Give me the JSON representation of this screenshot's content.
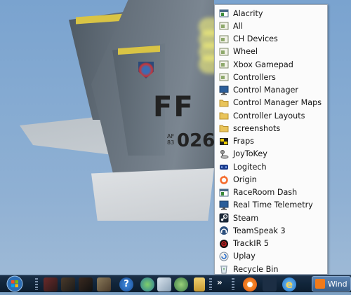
{
  "desktop": {
    "jet_markings": {
      "ff": "FF",
      "tail_number": "026",
      "af_line1": "AF",
      "af_line2": "83"
    }
  },
  "menu": {
    "items": [
      {
        "label": "Alacrity",
        "icon": "window-app-icon"
      },
      {
        "label": "All",
        "icon": "folder-shortcut-icon",
        "highlighted": true
      },
      {
        "label": "CH Devices",
        "icon": "folder-shortcut-icon",
        "highlighted": true
      },
      {
        "label": "Wheel",
        "icon": "folder-shortcut-icon",
        "highlighted": true
      },
      {
        "label": "Xbox Gamepad",
        "icon": "folder-shortcut-icon",
        "highlighted": true
      },
      {
        "label": "Controllers",
        "icon": "folder-shortcut-icon"
      },
      {
        "label": "Control Manager",
        "icon": "monitor-app-icon"
      },
      {
        "label": "Control Manager Maps",
        "icon": "folder-icon"
      },
      {
        "label": "Controller Layouts",
        "icon": "folder-icon"
      },
      {
        "label": "screenshots",
        "icon": "folder-icon"
      },
      {
        "label": "Fraps",
        "icon": "fraps-icon"
      },
      {
        "label": "JoyToKey",
        "icon": "joytokey-icon"
      },
      {
        "label": "Logitech",
        "icon": "logitech-icon"
      },
      {
        "label": "Origin",
        "icon": "origin-icon"
      },
      {
        "label": "RaceRoom Dash",
        "icon": "window-app-icon"
      },
      {
        "label": "Real Time Telemetry",
        "icon": "monitor-app-icon"
      },
      {
        "label": "Steam",
        "icon": "steam-icon"
      },
      {
        "label": "TeamSpeak 3",
        "icon": "teamspeak-icon"
      },
      {
        "label": "TrackIR 5",
        "icon": "trackir-icon"
      },
      {
        "label": "Uplay",
        "icon": "uplay-icon"
      },
      {
        "label": "Recycle Bin",
        "icon": "recycle-bin-icon"
      }
    ]
  },
  "taskbar": {
    "overflow_chevron": "»",
    "active_window_label": "Wind"
  },
  "colors": {
    "highlight": "#fffa78",
    "menu_bg": "#fbfbfb",
    "taskbar": "#11253a"
  }
}
